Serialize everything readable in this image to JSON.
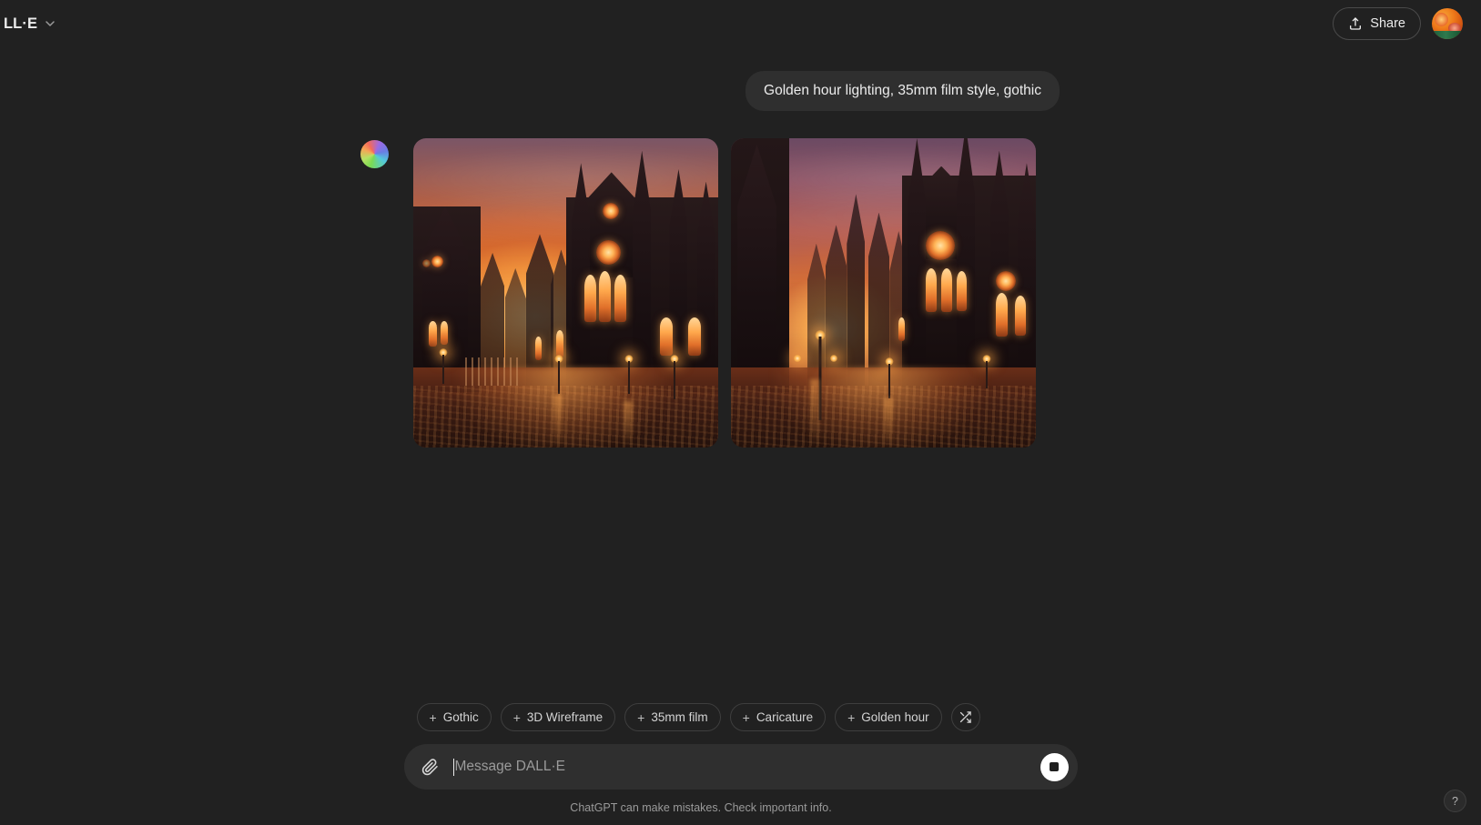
{
  "header": {
    "model_name": "LL·E",
    "model_chevron_icon": "chevron-down-icon",
    "share_label": "Share",
    "share_icon": "upload-icon",
    "avatar_alt": "user-avatar"
  },
  "conversation": {
    "user_message": "Golden hour lighting, 35mm film style, gothic",
    "assistant_avatar": "dalle-logo",
    "images": [
      {
        "alt": "Gothic cathedral at golden hour with orange sky, spires and lit stained glass windows"
      },
      {
        "alt": "Gothic cathedral at dusk with street lamp, purple sky and wet cobblestone street"
      }
    ]
  },
  "composer": {
    "chips": [
      {
        "prefix": "+",
        "label": "Gothic"
      },
      {
        "prefix": "+",
        "label": "3D Wireframe"
      },
      {
        "prefix": "+",
        "label": "35mm film"
      },
      {
        "prefix": "+",
        "label": "Caricature"
      },
      {
        "prefix": "+",
        "label": "Golden hour"
      }
    ],
    "shuffle_icon": "shuffle-icon",
    "attach_icon": "paperclip-icon",
    "input_value": "",
    "input_placeholder": "Message DALL·E",
    "stop_button_icon": "stop-icon",
    "footnote": "ChatGPT can make mistakes. Check important info.",
    "help_label": "?"
  },
  "colors": {
    "background": "#212121",
    "bubble": "#2f2f2f",
    "input": "#2f2f2f",
    "text": "#ececec",
    "muted": "#9a9a9a",
    "border": "#3e3e3e"
  }
}
